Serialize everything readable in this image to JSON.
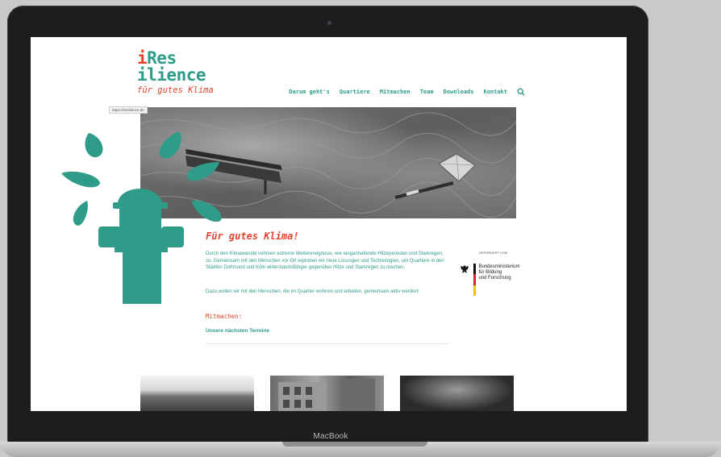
{
  "device": {
    "label": "MacBook"
  },
  "site": {
    "logo": {
      "line1": "Res",
      "line2": "ilience",
      "tagline": "für gutes Klima"
    },
    "nav": [
      "Darum geht's",
      "Quartiere",
      "Mitmachen",
      "Team",
      "Downloads",
      "Kontakt"
    ],
    "url_tooltip": "https://iresilience.de",
    "content": {
      "title": "Für gutes Klima!",
      "intro": "Durch den Klimawandel nehmen extreme Wetterereignisse, wie langanhaltende Hitzeperioden und Starkregen, zu. Gemeinsam mit den Menschen vor Ort erproben wir neue Lösungen und Technologien, um Quartiere in den Städten Dortmund und Köln widerstandsfähiger gegenüber Hitze und Starkregen zu machen.",
      "intro2": "Dazu wollen wir mit den Menschen, die im Quartier wohnen und arbeiten, gemeinsam aktiv werden!",
      "mitmachen_heading": "Mitmachen:",
      "termine_link": "Unsere nächsten Termine"
    },
    "sponsor": {
      "label": "GEFÖRDERT VOM",
      "ministry_lines": [
        "Bundesministerium",
        "für Bildung",
        "und Forschung"
      ]
    },
    "colors": {
      "teal": "#2e9c89",
      "red": "#e1452d"
    }
  }
}
